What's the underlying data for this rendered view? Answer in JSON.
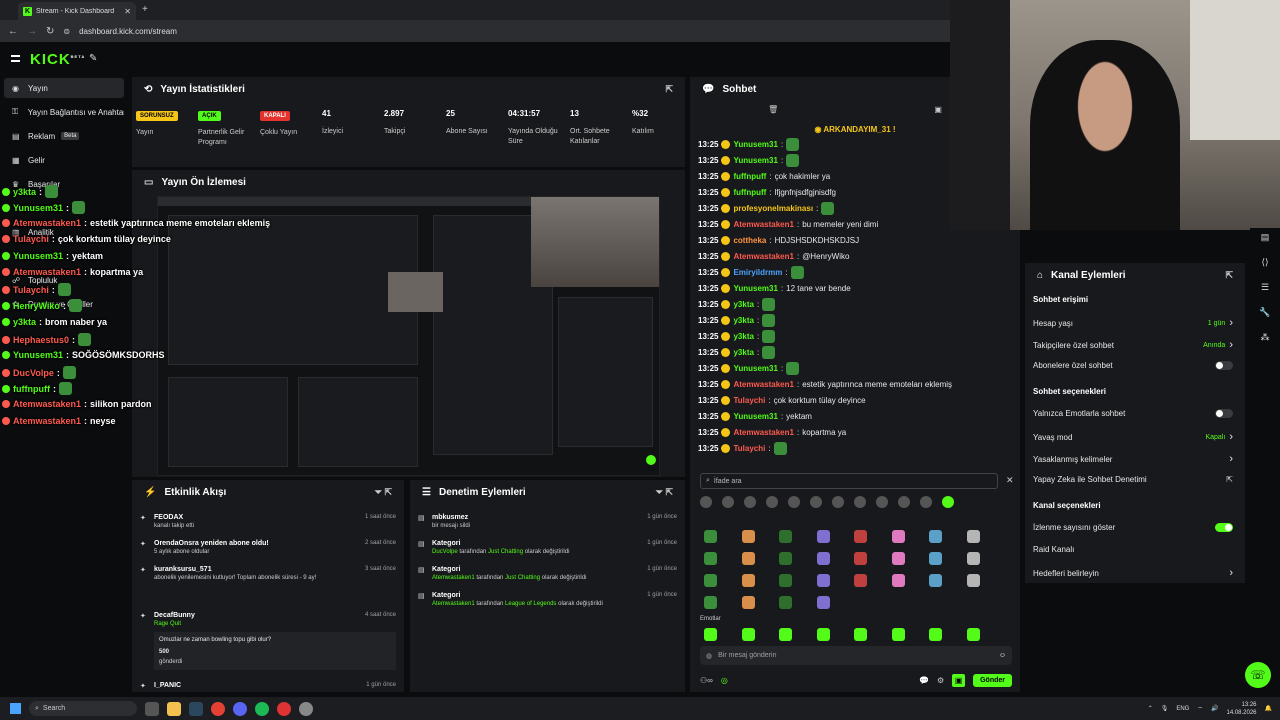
{
  "browser": {
    "tab_title": "Stream - Kick Dashboard",
    "url": "dashboard.kick.com/stream"
  },
  "sidebar": {
    "logo": "KICK",
    "logo_sup": "BETA",
    "items": [
      {
        "label": "Yayın",
        "icon": "broadcast-icon"
      },
      {
        "label": "Yayın Bağlantısı ve Anahtar",
        "icon": "key-icon"
      },
      {
        "label": "Reklam",
        "icon": "ad-icon",
        "badge": "Beta"
      },
      {
        "label": "Gelir",
        "icon": "money-icon"
      },
      {
        "label": "Başarılar",
        "icon": "trophy-icon"
      },
      {
        "label": "Analitik",
        "icon": "chart-icon"
      },
      {
        "label": "Topluluk",
        "icon": "users-icon"
      },
      {
        "label": "Droplar ve Ödüller",
        "icon": "gift-icon"
      }
    ]
  },
  "stats": {
    "title": "Yayın İstatistikleri",
    "items": [
      {
        "badge": "SORUNSUZ",
        "badge_color": "#f5c518",
        "label": "Yayın"
      },
      {
        "badge": "AÇIK",
        "badge_color": "#53fc18",
        "label": "Partnerlik Gelir Programı"
      },
      {
        "badge": "KAPALI",
        "badge_color": "#e5322d",
        "label": "Çoklu Yayın"
      },
      {
        "value": "41",
        "label": "İzleyici"
      },
      {
        "value": "2.897",
        "label": "Takipçi"
      },
      {
        "value": "25",
        "label": "Abone Sayısı"
      },
      {
        "value": "04:31:57",
        "label": "Yayında Olduğu Süre"
      },
      {
        "value": "13",
        "label": "Ort. Sohbete Katılanlar"
      },
      {
        "value": "%32",
        "label": "Katılım"
      }
    ]
  },
  "preview": {
    "title": "Yayın Ön İzlemesi"
  },
  "overlay_chat": [
    {
      "user": "y3kta",
      "color": "#53fc18",
      "msg": ""
    },
    {
      "user": "Yunusem31",
      "color": "#53fc18",
      "msg": ""
    },
    {
      "user": "Atemwastaken1",
      "color": "#ff5a4f",
      "msg": "estetik yaptırınca meme emoteları eklemiş"
    },
    {
      "user": "Tulaychi",
      "color": "#ff5a4f",
      "msg": "çok korktum tülay deyince"
    },
    {
      "user": "Yunusem31",
      "color": "#53fc18",
      "msg": "yektam"
    },
    {
      "user": "Atemwastaken1",
      "color": "#ff5a4f",
      "msg": "kopartma ya"
    },
    {
      "user": "Tulaychi",
      "color": "#ff5a4f",
      "msg": ""
    },
    {
      "user": "HenryWiko",
      "color": "#53fc18",
      "msg": ""
    },
    {
      "user": "y3kta",
      "color": "#53fc18",
      "msg": "brom naber ya"
    },
    {
      "user": "Hephaestus0",
      "color": "#ff5a4f",
      "msg": ""
    },
    {
      "user": "Yunusem31",
      "color": "#53fc18",
      "msg": "SOĞÖSÖMKSDORHS"
    },
    {
      "user": "DucVolpe",
      "color": "#ff5a4f",
      "msg": ""
    },
    {
      "user": "fuffnpuff",
      "color": "#53fc18",
      "msg": ""
    },
    {
      "user": "Atemwastaken1",
      "color": "#ff5a4f",
      "msg": "silikon pardon"
    },
    {
      "user": "Atemwastaken1",
      "color": "#ff5a4f",
      "msg": "neyse"
    }
  ],
  "activity": {
    "title": "Etkinlik Akışı",
    "items": [
      {
        "name": "FEODAX",
        "desc": "kanalı takip etti",
        "time": "1 saat önce"
      },
      {
        "name": "OrendaOnsra yeniden abone oldu!",
        "desc": "5 aylık abone oldular",
        "time": "2 saat önce"
      },
      {
        "name": "kuranksursu_571",
        "desc": "abonelik yenilemesini kutluyor! Toplam abonelik süresi - 9 ay!",
        "time": "3 saat önce"
      },
      {
        "name": "DecafBunny",
        "desc": "Rage Quit",
        "extra": "Omuzlar ne zaman bowling topu gibi olur?",
        "amount": "500",
        "sent": "gönderdi",
        "time": "4 saat önce"
      },
      {
        "name": "I_PANIC",
        "desc": "",
        "time": "1 gün önce"
      }
    ]
  },
  "moderation": {
    "title": "Denetim Eylemleri",
    "items": [
      {
        "name": "mbkusmez",
        "desc": "bir mesajı sildi",
        "time": "1 gün önce"
      },
      {
        "name": "Kategori",
        "who": "DucVolpe",
        "mid": "tarafından",
        "cat": "Just Chatting",
        "end": "olarak değiştirildi",
        "time": "1 gün önce"
      },
      {
        "name": "Kategori",
        "who": "Atemwastaken1",
        "mid": "tarafından",
        "cat": "Just Chatting",
        "end": "olarak değiştirildi",
        "time": "1 gün önce"
      },
      {
        "name": "Kategori",
        "who": "Atemwastaken1",
        "mid": "tarafından",
        "cat": "League of Legends",
        "end": "olarak değiştirildi",
        "time": "1 gün önce"
      }
    ]
  },
  "chat": {
    "title": "Sohbet",
    "pinned": "ARKANDAYIM_31",
    "messages": [
      {
        "time": "13:25",
        "user": "Yunusem31",
        "color": "#53fc18",
        "msg": ""
      },
      {
        "time": "13:25",
        "user": "Yunusem31",
        "color": "#53fc18",
        "msg": ""
      },
      {
        "time": "13:25",
        "user": "fuffnpuff",
        "color": "#53fc18",
        "msg": "çok hakimler ya"
      },
      {
        "time": "13:25",
        "user": "fuffnpuff",
        "color": "#53fc18",
        "msg": "lfjgnfnjsdfgjnisdfg"
      },
      {
        "time": "13:25",
        "user": "profesyonelmakinası",
        "color": "#f5c518",
        "msg": ""
      },
      {
        "time": "13:25",
        "user": "Atemwastaken1",
        "color": "#ff5a4f",
        "msg": "bu memeler yeni dimi"
      },
      {
        "time": "13:25",
        "user": "cottheka",
        "color": "#ff9340",
        "msg": "HDJSHSDKDHSKDJSJ"
      },
      {
        "time": "13:25",
        "user": "Atemwastaken1",
        "color": "#ff5a4f",
        "msg": "@HenryWiko"
      },
      {
        "time": "13:25",
        "user": "Emiryildrmm",
        "color": "#4da3ff",
        "msg": ""
      },
      {
        "time": "13:25",
        "user": "Yunusem31",
        "color": "#53fc18",
        "msg": "12 tane var bende"
      },
      {
        "time": "13:25",
        "user": "y3kta",
        "color": "#53fc18",
        "msg": ""
      },
      {
        "time": "13:25",
        "user": "y3kta",
        "color": "#53fc18",
        "msg": ""
      },
      {
        "time": "13:25",
        "user": "y3kta",
        "color": "#53fc18",
        "msg": ""
      },
      {
        "time": "13:25",
        "user": "y3kta",
        "color": "#53fc18",
        "msg": ""
      },
      {
        "time": "13:25",
        "user": "Yunusem31",
        "color": "#53fc18",
        "msg": ""
      },
      {
        "time": "13:25",
        "user": "Atemwastaken1",
        "color": "#ff5a4f",
        "msg": "estetik yaptırınca meme emoteları eklemiş"
      },
      {
        "time": "13:25",
        "user": "Tulaychi",
        "color": "#ff5a4f",
        "msg": "çok korktum tülay deyince"
      },
      {
        "time": "13:25",
        "user": "Yunusem31",
        "color": "#53fc18",
        "msg": "yektam"
      },
      {
        "time": "13:25",
        "user": "Atemwastaken1",
        "color": "#ff5a4f",
        "msg": "kopartma ya"
      },
      {
        "time": "13:25",
        "user": "Tulaychi",
        "color": "#ff5a4f",
        "msg": ""
      }
    ],
    "emote_search_placeholder": "İfade ara",
    "emote_section": "Emotlar",
    "input_placeholder": "Bir mesaj gönderin",
    "send_label": "Gönder"
  },
  "channel_actions": {
    "title": "Kanal Eylemleri",
    "sections": [
      {
        "title": "Sohbet erişimi",
        "rows": [
          {
            "label": "Hesap yaşı",
            "value": "1 gün",
            "type": "link"
          },
          {
            "label": "Takipçilere özel sohbet",
            "value": "Anında",
            "type": "link"
          },
          {
            "label": "Abonelere özel sohbet",
            "value": "",
            "type": "toggle-off"
          }
        ]
      },
      {
        "title": "Sohbet seçenekleri",
        "rows": [
          {
            "label": "Yalnızca Emotlarla sohbet",
            "value": "",
            "type": "toggle-off"
          },
          {
            "label": "Yavaş mod",
            "value": "Kapalı",
            "type": "link"
          },
          {
            "label": "Yasaklanmış kelimeler",
            "value": "",
            "type": "link"
          },
          {
            "label": "Yapay Zeka ile Sohbet Denetimi",
            "value": "",
            "type": "external"
          }
        ]
      },
      {
        "title": "Kanal seçenekleri",
        "rows": [
          {
            "label": "İzlenme sayısını göster",
            "value": "",
            "type": "toggle-on"
          },
          {
            "label": "Raid Kanalı",
            "value": "",
            "type": "none"
          },
          {
            "label": "Hedefleri belirleyin",
            "value": "",
            "type": "link"
          }
        ]
      }
    ]
  },
  "taskbar": {
    "search": "Search",
    "lang": "ENG",
    "time": "13:26",
    "date": "14.08.2026"
  }
}
